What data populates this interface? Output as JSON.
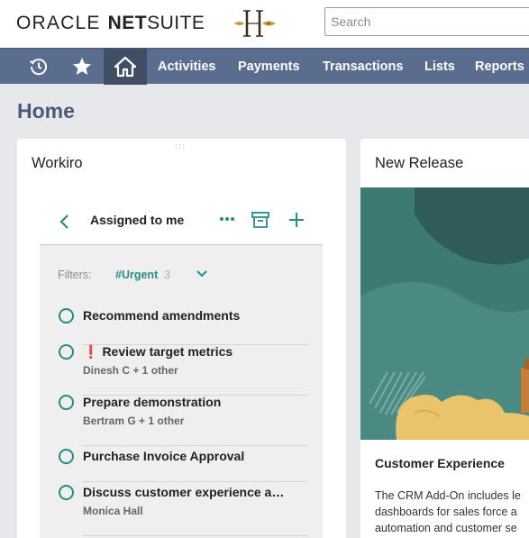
{
  "header": {
    "brand_oracle": "ORACLE",
    "brand_netsuite_bold": "NET",
    "brand_netsuite_rest": "SUITE",
    "search_placeholder": "Search"
  },
  "nav": {
    "icons": [
      "recent-history-icon",
      "favorites-star-icon",
      "home-icon"
    ],
    "items": [
      "Activities",
      "Payments",
      "Transactions",
      "Lists",
      "Reports"
    ]
  },
  "page": {
    "title": "Home"
  },
  "workiro": {
    "title": "Workiro",
    "drag_handle": ":::",
    "view_title": "Assigned to me",
    "filters_label": "Filters:",
    "filter_tag": "#Urgent",
    "filter_count": "3",
    "tasks": [
      {
        "title": "Recommend amendments",
        "sub": "",
        "urgent": false
      },
      {
        "title": "Review target metrics",
        "sub": "Dinesh C + 1 other",
        "urgent": true
      },
      {
        "title": "Prepare demonstration",
        "sub": "Bertram G + 1 other",
        "urgent": false
      },
      {
        "title": "Purchase Invoice Approval",
        "sub": "",
        "urgent": false
      },
      {
        "title": "Discuss customer experience a…",
        "sub": "Monica Hall",
        "urgent": false
      }
    ]
  },
  "new_release": {
    "title": "New Release",
    "heading": "Customer Experience",
    "text_lines": [
      "The CRM Add-On includes le",
      "dashboards for sales force a",
      "automation and customer se"
    ]
  },
  "colors": {
    "nav_bg": "#5a6d8f",
    "nav_active": "#3f4d65",
    "accent_teal": "#2a8a86",
    "title_color": "#4a5a78"
  }
}
